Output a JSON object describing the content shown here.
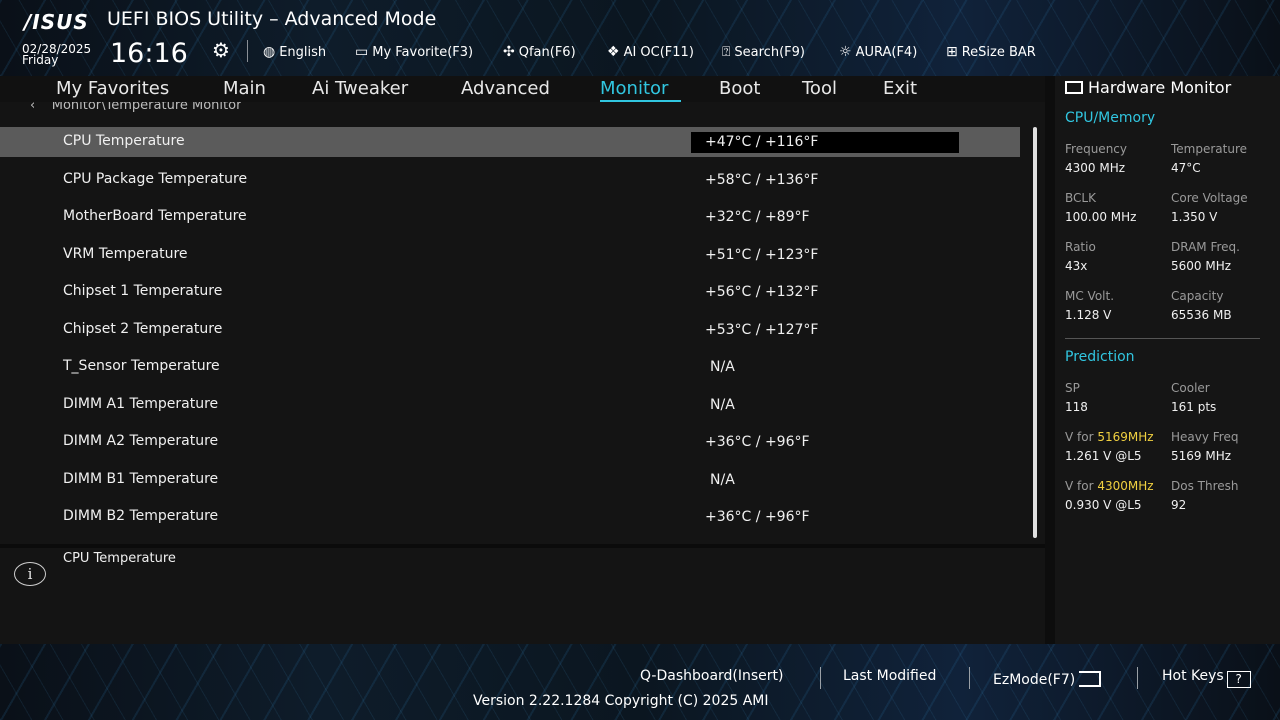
{
  "header": {
    "logo": "/ISUS",
    "title": "UEFI BIOS Utility – Advanced Mode",
    "date": "02/28/2025",
    "day": "Friday",
    "time": "16:16",
    "tools": [
      {
        "label": "English",
        "icon": "globe-icon"
      },
      {
        "label": "My Favorite(F3)",
        "icon": "favorite-icon"
      },
      {
        "label": "Qfan(F6)",
        "icon": "fan-icon"
      },
      {
        "label": "AI OC(F11)",
        "icon": "ai-chip-icon"
      },
      {
        "label": "Search(F9)",
        "icon": "search-icon"
      },
      {
        "label": "AURA(F4)",
        "icon": "aura-light-icon"
      },
      {
        "label": "ReSize BAR",
        "icon": "resize-bar-icon"
      }
    ]
  },
  "menu": {
    "items": [
      "My Favorites",
      "Main",
      "Ai Tweaker",
      "Advanced",
      "Monitor",
      "Boot",
      "Tool",
      "Exit"
    ],
    "active": "Monitor"
  },
  "breadcrumb": "Monitor\\Temperature Monitor",
  "rows": [
    {
      "label": "CPU Temperature",
      "value": "+47°C / +116°F"
    },
    {
      "label": "CPU Package Temperature",
      "value": "+58°C / +136°F"
    },
    {
      "label": "MotherBoard Temperature",
      "value": "+32°C / +89°F"
    },
    {
      "label": "VRM Temperature",
      "value": "+51°C / +123°F"
    },
    {
      "label": "Chipset 1 Temperature",
      "value": "+56°C / +132°F"
    },
    {
      "label": "Chipset 2 Temperature",
      "value": "+53°C / +127°F"
    },
    {
      "label": "T_Sensor Temperature",
      "value": "N/A"
    },
    {
      "label": "DIMM A1 Temperature",
      "value": "N/A"
    },
    {
      "label": "DIMM A2 Temperature",
      "value": "+36°C / +96°F"
    },
    {
      "label": "DIMM B1 Temperature",
      "value": "N/A"
    },
    {
      "label": "DIMM B2 Temperature",
      "value": "+36°C / +96°F"
    }
  ],
  "help": {
    "text": "CPU Temperature"
  },
  "hardware_monitor": {
    "title": "Hardware Monitor",
    "cpu_memory": {
      "heading": "CPU/Memory",
      "frequency_label": "Frequency",
      "frequency": "4300 MHz",
      "temperature_label": "Temperature",
      "temperature": "47°C",
      "bclk_label": "BCLK",
      "bclk": "100.00 MHz",
      "core_voltage_label": "Core Voltage",
      "core_voltage": "1.350 V",
      "ratio_label": "Ratio",
      "ratio": "43x",
      "dram_freq_label": "DRAM Freq.",
      "dram_freq": "5600 MHz",
      "mc_volt_label": "MC Volt.",
      "mc_volt": "1.128 V",
      "capacity_label": "Capacity",
      "capacity": "65536 MB"
    },
    "prediction": {
      "heading": "Prediction",
      "sp_label": "SP",
      "sp": "118",
      "cooler_label": "Cooler",
      "cooler": "161 pts",
      "v_for_label": "V for",
      "v_for_freq1": "5169MHz",
      "v_for_val1": "1.261 V @L5",
      "heavy_freq_label": "Heavy Freq",
      "heavy_freq": "5169 MHz",
      "v_for_freq2": "4300MHz",
      "v_for_val2": "0.930 V @L5",
      "dos_thresh_label": "Dos Thresh",
      "dos_thresh": "92"
    }
  },
  "footer": {
    "qdashboard": "Q-Dashboard(Insert)",
    "last_modified": "Last Modified",
    "ezmode": "EzMode(F7)",
    "hotkeys": "Hot Keys",
    "hotkeys_key": "?",
    "version": "Version 2.22.1284 Copyright (C) 2025 AMI"
  },
  "colors": {
    "accent": "#31c6e0",
    "highlight": "#f0d040",
    "selected_row": "#5b5b5b"
  }
}
